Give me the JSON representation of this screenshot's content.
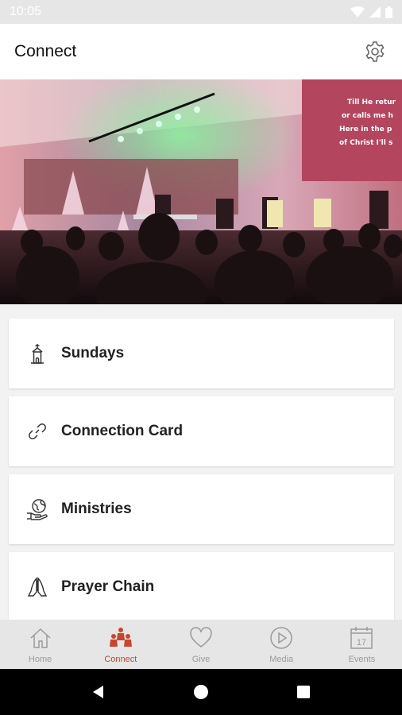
{
  "status_bar": {
    "time": "10:05"
  },
  "app_bar": {
    "title": "Connect"
  },
  "hero": {
    "screen_lines": [
      "Till He retur",
      "or calls me h",
      "Here in the p",
      "of Christ I'll s"
    ]
  },
  "menu": [
    {
      "label": "Sundays",
      "icon": "church-icon"
    },
    {
      "label": "Connection Card",
      "icon": "link-icon"
    },
    {
      "label": "Ministries",
      "icon": "globe-hand-icon"
    },
    {
      "label": "Prayer Chain",
      "icon": "praying-hands-icon"
    }
  ],
  "bottom_nav": [
    {
      "label": "Home",
      "icon": "home-icon"
    },
    {
      "label": "Connect",
      "icon": "people-icon"
    },
    {
      "label": "Give",
      "icon": "heart-icon"
    },
    {
      "label": "Media",
      "icon": "play-icon"
    },
    {
      "label": "Events",
      "icon": "calendar-icon",
      "calendar_day": "17"
    }
  ],
  "colors": {
    "accent": "#c8452e",
    "inactive": "#9a9a9a",
    "background": "#f2f2f2"
  }
}
